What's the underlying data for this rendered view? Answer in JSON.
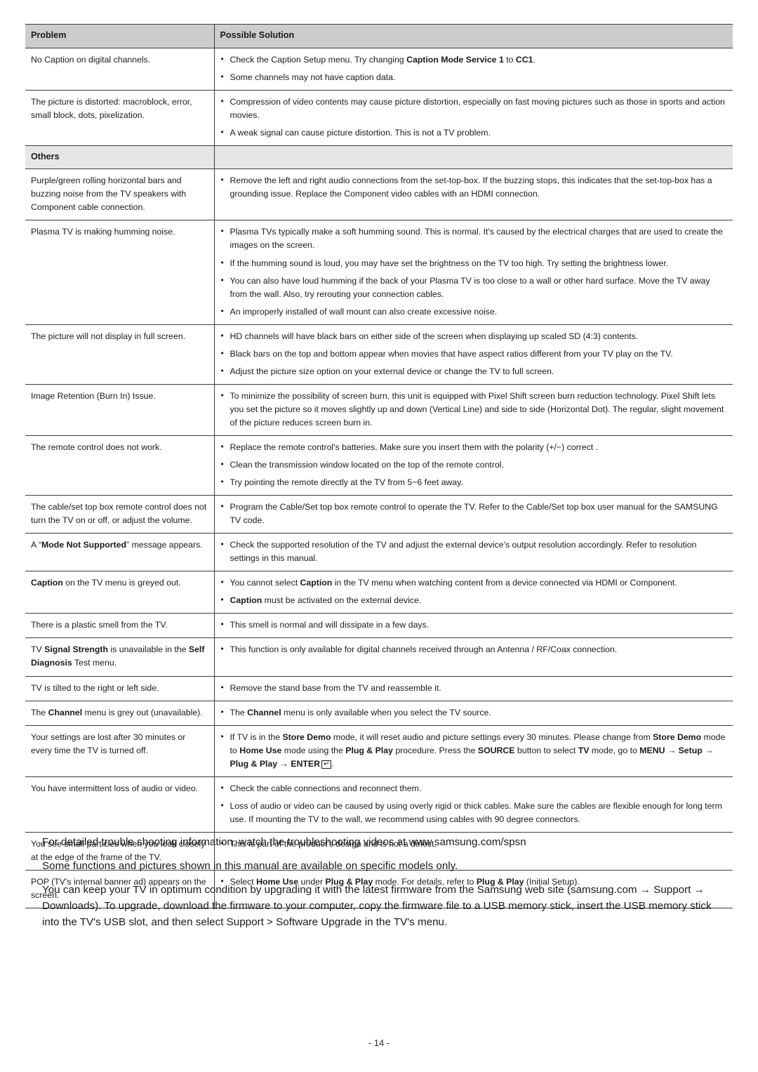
{
  "page": {
    "number_label": "- 14 -"
  },
  "table": {
    "headers": {
      "problem": "Problem",
      "solution": "Possible Solution"
    },
    "section_label": "Others",
    "rows": [
      {
        "problem_html": "No Caption on digital channels.",
        "solutions_html": [
          "Check the Caption Setup menu. Try changing <b>Caption Mode Service 1</b> to <b>CC1</b>.",
          "Some channels may not have caption data."
        ]
      },
      {
        "problem_html": "The picture is distorted: macroblock, error, small block, dots, pixelization.",
        "solutions_html": [
          "Compression of video contents may cause picture distortion, especially on fast moving pictures such as those in sports and action movies.",
          "A weak signal can cause picture distortion. This is not a TV problem."
        ]
      },
      {
        "problem_html": "Purple/green rolling horizontal bars and buzzing noise from the TV speakers with Component cable connection.",
        "solutions_html": [
          "Remove the left and right audio connections from the set-top-box. If the buzzing stops, this indicates that the set-top-box has a grounding issue. Replace the Component video cables with an HDMI connection."
        ]
      },
      {
        "problem_html": "Plasma TV is making humming noise.",
        "solutions_html": [
          "Plasma TVs typically make a soft humming sound. This is normal. It's caused by the electrical charges that are used to create the images on the screen.",
          "If the humming sound is loud, you may have set the brightness on the TV too high. Try setting the brightness lower.",
          "You can also have loud humming if the back of your Plasma TV is too close to a wall or other hard surface. Move the TV away from the wall. Also, try rerouting your connection cables.",
          "An improperly installed of wall mount can also create excessive noise."
        ]
      },
      {
        "problem_html": "The picture will not display in full screen.",
        "solutions_html": [
          "HD channels will have black bars on either side of the screen when displaying up scaled SD (4:3) contents.",
          "Black bars on the top and bottom appear when movies that have aspect ratios different from your TV play on the TV.",
          "Adjust the picture size option on your external device or change the TV to full screen."
        ]
      },
      {
        "problem_html": "Image Retention (Burn In) Issue.",
        "solutions_html": [
          "To minimize the possibility of screen burn, this unit is equipped with Pixel Shift screen burn reduction technology. Pixel Shift lets you set the picture so it moves slightly up and down (Vertical Line) and side to side (Horizontal Dot). The regular, slight movement of the picture reduces screen burn in."
        ]
      },
      {
        "problem_html": "The remote control does not work.",
        "solutions_html": [
          "Replace the remote control's batteries. Make sure you insert them with the polarity (+/&#8722;) correct .",
          "Clean the transmission window located on the top of the remote control.",
          "Try pointing the remote directly at the TV from 5~6 feet away."
        ]
      },
      {
        "problem_html": "The cable/set top box remote control does not turn the TV on or off, or adjust the volume.",
        "solutions_html": [
          "Program the Cable/Set top box remote control to operate the TV. Refer to the Cable/Set top box user manual for the SAMSUNG TV code."
        ]
      },
      {
        "problem_html": "A “<b>Mode Not Supported</b>” message appears.",
        "solutions_html": [
          "Check the supported resolution of the TV and adjust the external device's output resolution accordingly. Refer to resolution settings in this manual."
        ]
      },
      {
        "problem_html": "<b>Caption</b> on the TV menu is greyed out.",
        "solutions_html": [
          "You cannot select <b>Caption</b> in the TV menu when watching content from a device connected via HDMI or Component.",
          "<b>Caption</b> must be activated on the external device."
        ]
      },
      {
        "problem_html": "There is a plastic smell from the TV.",
        "solutions_html": [
          "This smell is normal and will dissipate in a few days."
        ]
      },
      {
        "problem_html": "TV <b>Signal Strength</b> is unavailable in the <b>Self Diagnosis</b> Test menu.",
        "solutions_html": [
          "This function is only available for digital channels received through an Antenna / RF/Coax connection."
        ]
      },
      {
        "problem_html": "TV is tilted to the right or left side.",
        "solutions_html": [
          "Remove the stand base from the TV and reassemble it."
        ]
      },
      {
        "problem_html": "The <b>Channel</b> menu is grey out (unavailable).",
        "solutions_html": [
          "The <b>Channel</b> menu is only available when you select the TV source."
        ]
      },
      {
        "problem_html": "Your settings are lost after 30 minutes or every time the TV is turned off.",
        "solutions_html": [
          "If TV is in the <b>Store Demo</b> mode, it will reset audio and picture settings every 30 minutes. Please change from <b>Store Demo</b> mode to <b>Home Use</b> mode using the <b>Plug &amp; Play</b> procedure. Press the <b>SOURCE</b> button to select <b>TV</b> mode, go to <b>MENU</b> → <b>Setup</b> → <b>Plug &amp; Play</b> → <b>ENTER</b><span class=\"enter-key\">↵</span>."
        ]
      },
      {
        "problem_html": "You have intermittent loss of audio or video.",
        "solutions_html": [
          "Check the cable connections and reconnect them.",
          "Loss of audio or video can be caused by using overly rigid or thick cables. Make sure the cables are flexible enough for long term use. If mounting the TV to the wall, we recommend using cables with 90 degree connectors."
        ]
      },
      {
        "problem_html": "You see small particles when you look closely at the edge of the frame of the TV.",
        "solutions_html": [
          "This is part of the product’s design and is not a defect."
        ]
      },
      {
        "problem_html": "POP (TV's internal banner ad) appears on the screen.",
        "solutions_html": [
          "Select <b>Home Use</b> under <b>Plug &amp; Play</b> mode. For details, refer to <b>Plug &amp; Play</b> (Initial Setup)."
        ]
      }
    ],
    "section_after_row_index": 2
  },
  "notes": [
    "For detailed trouble shooting information, watch the troubleshooting videos at  www.samsung.com/spsn",
    "Some functions and pictures shown in this manual are available on specific models only.",
    "You can keep your TV in optimum condition by upgrading it with the latest firmware from the Samsung web site (samsung.com → Support → Downloads). To upgrade, download the firmware to your computer, copy the firmware file to a USB memory stick, insert the USB memory stick into the TV's USB slot, and then select Support > Software Upgrade in the TV's menu."
  ],
  "colors": {
    "header_bg": "#cccccc",
    "section_bg": "#e6e6e6",
    "rule": "#3c3c3c",
    "text": "#1a1a1a"
  }
}
